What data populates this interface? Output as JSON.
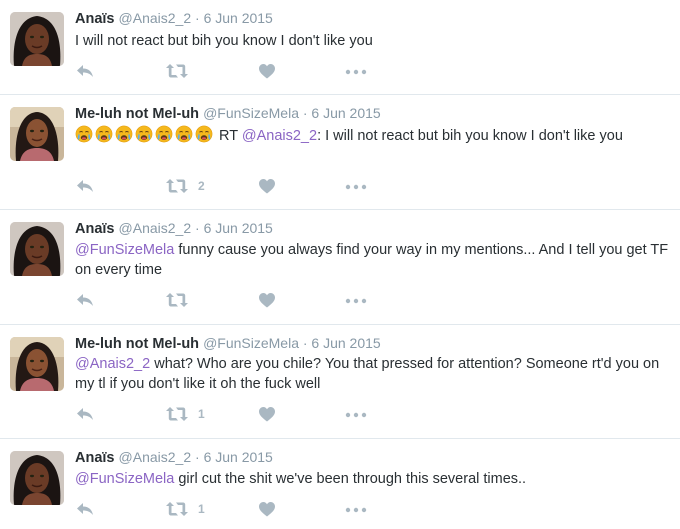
{
  "tweets": [
    {
      "name": "Anaïs",
      "meta": "@Anais2_2 · 6 Jun 2015",
      "segments": [
        {
          "t": "I will not react but bih you know I don't like you",
          "m": false
        }
      ],
      "retweet_count": ""
    },
    {
      "name": "Me-luh not Mel-uh",
      "meta": "@FunSizeMela · 6 Jun 2015",
      "emoji_count": 7,
      "segments": [
        {
          "t": " RT ",
          "m": false
        },
        {
          "t": "@Anais2_2",
          "m": true
        },
        {
          "t": ": I will not react but bih you know I don't like you",
          "m": false
        }
      ],
      "retweet_count": "2"
    },
    {
      "name": "Anaïs",
      "meta": "@Anais2_2 · 6 Jun 2015",
      "segments": [
        {
          "t": "@FunSizeMela",
          "m": true
        },
        {
          "t": " funny cause you always find your way in my mentions... And I tell you get TF on every time",
          "m": false
        }
      ],
      "retweet_count": ""
    },
    {
      "name": "Me-luh not Mel-uh",
      "meta": "@FunSizeMela · 6 Jun 2015",
      "segments": [
        {
          "t": "@Anais2_2",
          "m": true
        },
        {
          "t": " what? Who are you chile? You that pressed for attention? Someone rt'd you on my tl if you don't like it oh the fuck well",
          "m": false
        }
      ],
      "retweet_count": "1"
    },
    {
      "name": "Anaïs",
      "meta": "@Anais2_2 · 6 Jun 2015",
      "segments": [
        {
          "t": "@FunSizeMela",
          "m": true
        },
        {
          "t": " girl cut the shit we've been through this several times..",
          "m": false
        }
      ],
      "retweet_count": "1"
    }
  ],
  "colors": {
    "mention": "#8b65c4",
    "action_icon": "#aab8c2",
    "divider": "#e1e8ed"
  },
  "icons": [
    "reply-icon",
    "retweet-icon",
    "like-icon",
    "more-icon",
    "crying-face-emoji"
  ]
}
